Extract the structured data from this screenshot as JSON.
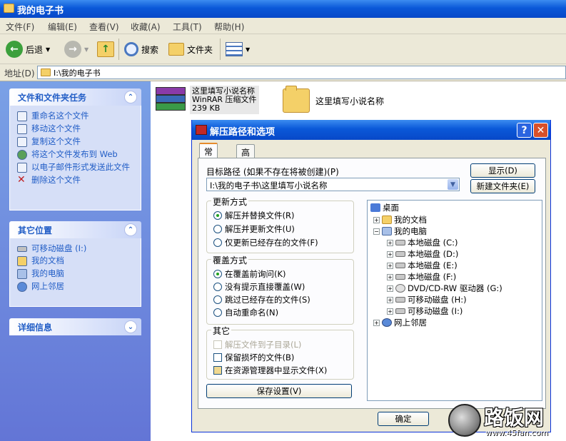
{
  "window": {
    "title": "我的电子书"
  },
  "menu": [
    "文件(F)",
    "编辑(E)",
    "查看(V)",
    "收藏(A)",
    "工具(T)",
    "帮助(H)"
  ],
  "toolbar": {
    "back": "后退",
    "search": "搜索",
    "folders": "文件夹"
  },
  "address": {
    "label": "地址(D)",
    "value": "I:\\我的电子书"
  },
  "tasks": {
    "file_tasks": {
      "title": "文件和文件夹任务",
      "items": [
        "重命名这个文件",
        "移动这个文件",
        "复制这个文件",
        "将这个文件发布到 Web",
        "以电子邮件形式发送此文件",
        "删除这个文件"
      ]
    },
    "other_places": {
      "title": "其它位置",
      "items": [
        "可移动磁盘 (I:)",
        "我的文档",
        "我的电脑",
        "网上邻居"
      ]
    },
    "details": {
      "title": "详细信息"
    }
  },
  "files": [
    {
      "name": "这里填写小说名称",
      "type": "WinRAR 压缩文件",
      "size": "239 KB"
    },
    {
      "name": "这里填写小说名称"
    }
  ],
  "dialog": {
    "title": "解压路径和选项",
    "tabs": [
      "常规",
      "高级"
    ],
    "target_label": "目标路径 (如果不存在将被创建)(P)",
    "target_value": "I:\\我的电子书\\这里填写小说名称",
    "show_button": "显示(D)",
    "new_folder_button": "新建文件夹(E)",
    "update_mode": {
      "title": "更新方式",
      "options": [
        "解压并替换文件(R)",
        "解压并更新文件(U)",
        "仅更新已经存在的文件(F)"
      ]
    },
    "overwrite_mode": {
      "title": "覆盖方式",
      "options": [
        "在覆盖前询问(K)",
        "没有提示直接覆盖(W)",
        "跳过已经存在的文件(S)",
        "自动重命名(N)"
      ]
    },
    "misc": {
      "title": "其它",
      "options": [
        "解压文件到子目录(L)",
        "保留损坏的文件(B)",
        "在资源管理器中显示文件(X)"
      ]
    },
    "save_button": "保存设置(V)",
    "ok_button": "确定",
    "tree": {
      "root": "桌面",
      "items": [
        {
          "label": "我的文档",
          "level": 1
        },
        {
          "label": "我的电脑",
          "level": 1
        },
        {
          "label": "本地磁盘 (C:)",
          "level": 2
        },
        {
          "label": "本地磁盘 (D:)",
          "level": 2
        },
        {
          "label": "本地磁盘 (E:)",
          "level": 2
        },
        {
          "label": "本地磁盘 (F:)",
          "level": 2
        },
        {
          "label": "DVD/CD-RW 驱动器 (G:)",
          "level": 2
        },
        {
          "label": "可移动磁盘 (H:)",
          "level": 2
        },
        {
          "label": "可移动磁盘 (I:)",
          "level": 2
        },
        {
          "label": "网上邻居",
          "level": 1
        }
      ]
    }
  },
  "watermark": {
    "title": "路饭网",
    "url": "www.45fan.com"
  }
}
